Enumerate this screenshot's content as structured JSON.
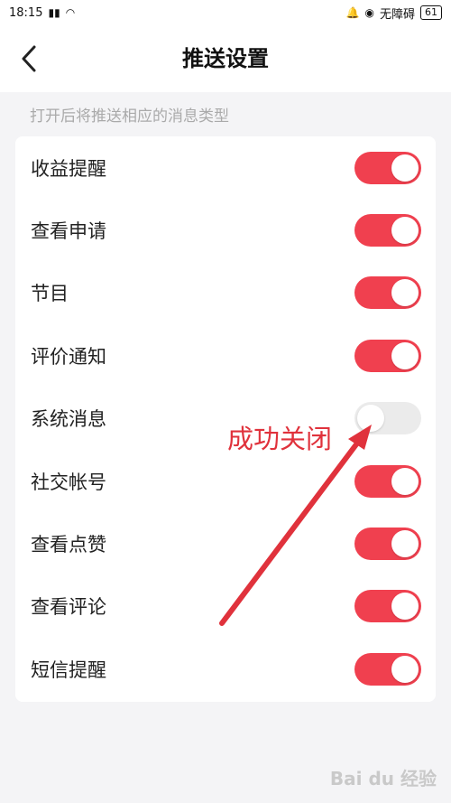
{
  "status_bar": {
    "time": "18:15",
    "accessibility": "无障碍",
    "battery": "61"
  },
  "header": {
    "title": "推送设置"
  },
  "hint": "打开后将推送相应的消息类型",
  "settings": [
    {
      "label": "收益提醒",
      "enabled": true
    },
    {
      "label": "查看申请",
      "enabled": true
    },
    {
      "label": "节目",
      "enabled": true
    },
    {
      "label": "评价通知",
      "enabled": true
    },
    {
      "label": "系统消息",
      "enabled": false
    },
    {
      "label": "社交帐号",
      "enabled": true
    },
    {
      "label": "查看点赞",
      "enabled": true
    },
    {
      "label": "查看评论",
      "enabled": true
    },
    {
      "label": "短信提醒",
      "enabled": true
    }
  ],
  "annotation": "成功关闭",
  "watermark": "Bai du 经验",
  "colors": {
    "toggle_on": "#f0404f",
    "toggle_off": "#ebebeb",
    "annotation": "#e0323c"
  }
}
